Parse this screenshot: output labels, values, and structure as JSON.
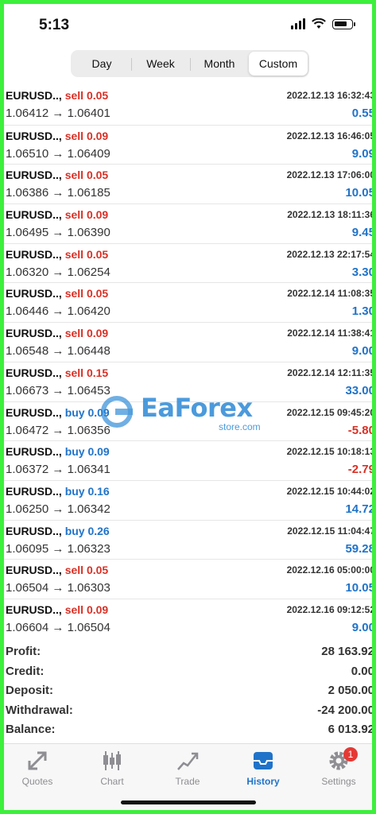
{
  "status": {
    "time": "5:13"
  },
  "period_tabs": [
    "Day",
    "Week",
    "Month",
    "Custom"
  ],
  "active_period": "Custom",
  "trades": [
    {
      "symbol": "EURUSD..,",
      "side": "sell",
      "volume": "0.05",
      "open": "1.06412",
      "close": "1.06401",
      "time": "2022.12.13 16:32:43",
      "profit": "0.55"
    },
    {
      "symbol": "EURUSD..,",
      "side": "sell",
      "volume": "0.09",
      "open": "1.06510",
      "close": "1.06409",
      "time": "2022.12.13 16:46:05",
      "profit": "9.09"
    },
    {
      "symbol": "EURUSD..,",
      "side": "sell",
      "volume": "0.05",
      "open": "1.06386",
      "close": "1.06185",
      "time": "2022.12.13 17:06:00",
      "profit": "10.05"
    },
    {
      "symbol": "EURUSD..,",
      "side": "sell",
      "volume": "0.09",
      "open": "1.06495",
      "close": "1.06390",
      "time": "2022.12.13 18:11:36",
      "profit": "9.45"
    },
    {
      "symbol": "EURUSD..,",
      "side": "sell",
      "volume": "0.05",
      "open": "1.06320",
      "close": "1.06254",
      "time": "2022.12.13 22:17:54",
      "profit": "3.30"
    },
    {
      "symbol": "EURUSD..,",
      "side": "sell",
      "volume": "0.05",
      "open": "1.06446",
      "close": "1.06420",
      "time": "2022.12.14 11:08:35",
      "profit": "1.30"
    },
    {
      "symbol": "EURUSD..,",
      "side": "sell",
      "volume": "0.09",
      "open": "1.06548",
      "close": "1.06448",
      "time": "2022.12.14 11:38:41",
      "profit": "9.00"
    },
    {
      "symbol": "EURUSD..,",
      "side": "sell",
      "volume": "0.15",
      "open": "1.06673",
      "close": "1.06453",
      "time": "2022.12.14 12:11:35",
      "profit": "33.00"
    },
    {
      "symbol": "EURUSD..,",
      "side": "buy",
      "volume": "0.09",
      "open": "1.06472",
      "close": "1.06356",
      "time": "2022.12.15 09:45:20",
      "profit": "-5.80"
    },
    {
      "symbol": "EURUSD..,",
      "side": "buy",
      "volume": "0.09",
      "open": "1.06372",
      "close": "1.06341",
      "time": "2022.12.15 10:18:13",
      "profit": "-2.79"
    },
    {
      "symbol": "EURUSD..,",
      "side": "buy",
      "volume": "0.16",
      "open": "1.06250",
      "close": "1.06342",
      "time": "2022.12.15 10:44:02",
      "profit": "14.72"
    },
    {
      "symbol": "EURUSD..,",
      "side": "buy",
      "volume": "0.26",
      "open": "1.06095",
      "close": "1.06323",
      "time": "2022.12.15 11:04:47",
      "profit": "59.28"
    },
    {
      "symbol": "EURUSD..,",
      "side": "sell",
      "volume": "0.05",
      "open": "1.06504",
      "close": "1.06303",
      "time": "2022.12.16 05:00:00",
      "profit": "10.05"
    },
    {
      "symbol": "EURUSD..,",
      "side": "sell",
      "volume": "0.09",
      "open": "1.06604",
      "close": "1.06504",
      "time": "2022.12.16 09:12:52",
      "profit": "9.00"
    }
  ],
  "summary": [
    {
      "label": "Profit:",
      "value": "28 163.92"
    },
    {
      "label": "Credit:",
      "value": "0.00"
    },
    {
      "label": "Deposit:",
      "value": "2 050.00"
    },
    {
      "label": "Withdrawal:",
      "value": "-24 200.00"
    },
    {
      "label": "Balance:",
      "value": "6 013.92"
    }
  ],
  "watermark": {
    "text": "EaForex",
    "sub": "store.com"
  },
  "tabbar": {
    "items": [
      {
        "label": "Quotes",
        "icon": "quotes-icon"
      },
      {
        "label": "Chart",
        "icon": "chart-icon"
      },
      {
        "label": "Trade",
        "icon": "trade-icon"
      },
      {
        "label": "History",
        "icon": "history-icon"
      },
      {
        "label": "Settings",
        "icon": "settings-icon",
        "badge": "1"
      }
    ],
    "active": "History"
  },
  "colors": {
    "sell": "#d93025",
    "buy": "#1f73c9",
    "profit_pos": "#1f73c9",
    "profit_neg": "#d93025",
    "active_tab": "#1f73c9",
    "frame": "#3cf03c"
  }
}
